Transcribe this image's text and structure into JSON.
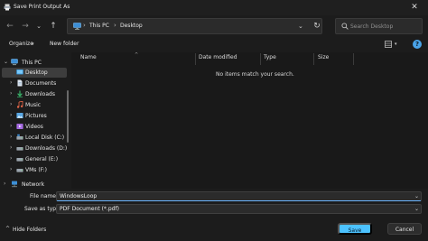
{
  "window": {
    "title": "Save Print Output As",
    "close_glyph": "✕"
  },
  "nav": {
    "back_glyph": "←",
    "forward_glyph": "→",
    "recent_glyph": "⌄",
    "up_glyph": "↑",
    "refresh_glyph": "↻",
    "address": {
      "sep_glyph": "›",
      "crumbs": [
        "This PC",
        "Desktop"
      ],
      "dropdown_glyph": "⌄"
    },
    "search_placeholder": "Search Desktop"
  },
  "commandbar": {
    "organize_label": "Organize",
    "organize_dd_glyph": "▾",
    "new_folder_label": "New folder",
    "view_dd_glyph": "▾",
    "help_glyph": "?"
  },
  "sidebar": {
    "items": [
      {
        "label": "This PC",
        "icon": "pc-icon",
        "chevron": "⌄"
      },
      {
        "label": "Desktop",
        "icon": "desktop-folder-icon",
        "chevron": "",
        "selected": true
      },
      {
        "label": "Documents",
        "icon": "documents-folder-icon",
        "chevron": "›"
      },
      {
        "label": "Downloads",
        "icon": "downloads-folder-icon",
        "chevron": "›"
      },
      {
        "label": "Music",
        "icon": "music-folder-icon",
        "chevron": "›"
      },
      {
        "label": "Pictures",
        "icon": "pictures-folder-icon",
        "chevron": "›"
      },
      {
        "label": "Videos",
        "icon": "videos-folder-icon",
        "chevron": "›"
      },
      {
        "label": "Local Disk (C:)",
        "icon": "drive-icon",
        "chevron": "›"
      },
      {
        "label": "Downloads (D:)",
        "icon": "drive-icon",
        "chevron": "›"
      },
      {
        "label": "General (E:)",
        "icon": "drive-icon",
        "chevron": "›"
      },
      {
        "label": "VMs (F:)",
        "icon": "drive-icon",
        "chevron": "›"
      },
      {
        "label": "Network",
        "icon": "network-icon",
        "chevron": "›"
      }
    ]
  },
  "filelist": {
    "columns": [
      "Name",
      "Date modified",
      "Type",
      "Size"
    ],
    "sort_glyph": "^",
    "empty_message": "No items match your search."
  },
  "form": {
    "file_name_label": "File name:",
    "file_name_value": "WindowsLoop",
    "save_type_label": "Save as type:",
    "save_type_value": "PDF Document (*.pdf)",
    "dropdown_glyph": "⌄"
  },
  "footer": {
    "hide_folders_label": "Hide Folders",
    "hide_chevron_glyph": "^",
    "save_label": "Save",
    "cancel_label": "Cancel"
  },
  "colors": {
    "accent": "#4cc2ff",
    "background": "#1c1c1c",
    "selected": "#3d3d3d"
  }
}
